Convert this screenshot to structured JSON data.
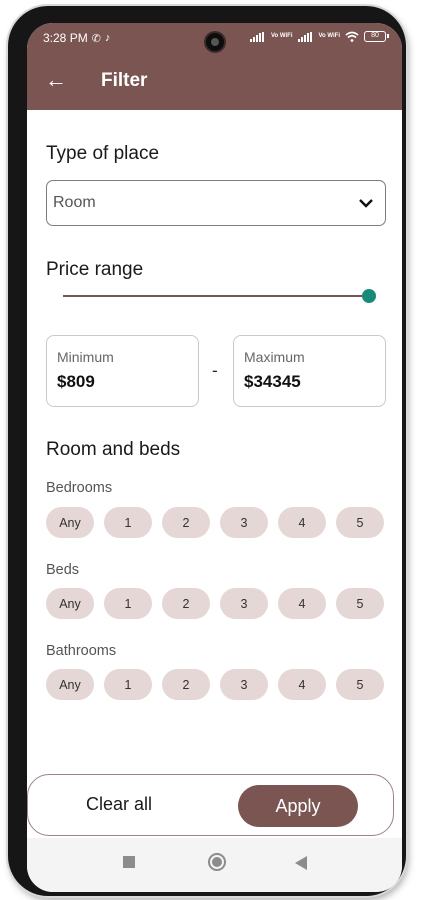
{
  "status_bar": {
    "time": "3:28 PM",
    "wifi1": "Vo WiFi",
    "wifi2": "Vo WiFi",
    "battery": "80"
  },
  "header": {
    "title": "Filter"
  },
  "type_of_place": {
    "label": "Type of place",
    "selected": "Room"
  },
  "price": {
    "label": "Price range",
    "slider_fraction": 1.0,
    "min_label": "Minimum",
    "min_value": "$809",
    "separator": "-",
    "max_label": "Maximum",
    "max_value": "$34345"
  },
  "rooms": {
    "label": "Room and beds",
    "groups": [
      {
        "label": "Bedrooms",
        "options": [
          "Any",
          "1",
          "2",
          "3",
          "4",
          "5"
        ]
      },
      {
        "label": "Beds",
        "options": [
          "Any",
          "1",
          "2",
          "3",
          "4",
          "5"
        ]
      },
      {
        "label": "Bathrooms",
        "options": [
          "Any",
          "1",
          "2",
          "3",
          "4",
          "5"
        ]
      }
    ]
  },
  "footer": {
    "clear_label": "Clear all",
    "apply_label": "Apply"
  },
  "colors": {
    "accent": "#7a5552",
    "chip": "#e4d7d5",
    "slider_thumb": "#1a8a78"
  }
}
